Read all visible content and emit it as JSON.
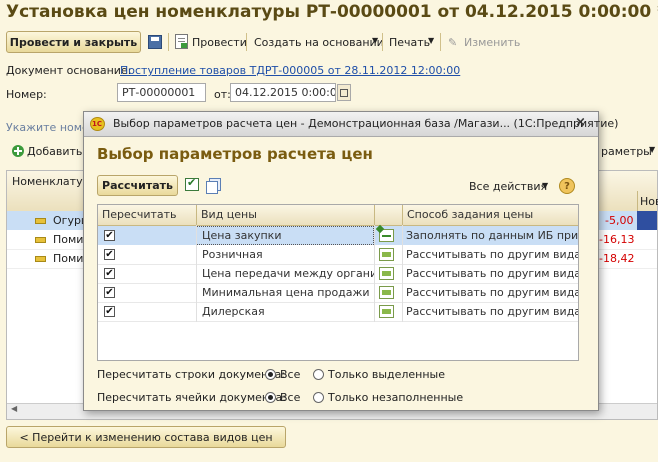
{
  "document": {
    "title": "Установка цен номенклатуры РТ-00000001 от 04.12.2015 0:00:00 *",
    "toolbar": {
      "post_close": "Провести и закрыть",
      "post": "Провести",
      "create_based": "Создать на основании",
      "print": "Печать",
      "edit": "Изменить"
    },
    "basis_label": "Документ основание:",
    "basis_link": "Поступление товаров ТДРТ-000005 от 28.11.2012 12:00:00",
    "number_label": "Номер:",
    "number_value": "РТ-00000001",
    "date_label": "от:",
    "date_value": "04.12.2015  0:00:00",
    "hint_fragment": "Укажите номе",
    "add_fragment": "Добавить",
    "params_fragment": "раметры",
    "table": {
      "col_nom": "Номенклатур",
      "col_new": "Нов",
      "rows": [
        {
          "name": "Огурц",
          "value": "-5,00"
        },
        {
          "name": "Поми",
          "value": "-16,13"
        },
        {
          "name": "Поми",
          "value": "-18,42"
        }
      ]
    },
    "back_button": "< Перейти к изменению состава видов цен"
  },
  "dialog": {
    "window_title": "Выбор параметров расчета цен - Демонстрационная база /Магази...  (1С:Предприятие)",
    "heading": "Выбор параметров расчета цен",
    "calc_button": "Рассчитать",
    "all_actions": "Все действия",
    "help": "?",
    "columns": {
      "recalc": "Пересчитать",
      "price_type": "Вид цены",
      "method": "Способ задания цены"
    },
    "rows": [
      {
        "checked": true,
        "price_type": "Цена закупки",
        "method": "Заполнять по данным ИБ при ...",
        "selected": true
      },
      {
        "checked": true,
        "price_type": "Розничная",
        "method": "Рассчитывать по другим вида...",
        "selected": false
      },
      {
        "checked": true,
        "price_type": "Цена передачи между организ...",
        "method": "Рассчитывать по другим вида...",
        "selected": false
      },
      {
        "checked": true,
        "price_type": "Минимальная цена продажи в ...",
        "method": "Рассчитывать по другим вида...",
        "selected": false
      },
      {
        "checked": true,
        "price_type": "Дилерская",
        "method": "Рассчитывать по другим вида...",
        "selected": false
      }
    ],
    "recalc_rows_label": "Пересчитать строки документа:",
    "recalc_rows_all": "Все",
    "recalc_rows_selected": "Только выделенные",
    "recalc_cells_label": "Пересчитать ячейки документа:",
    "recalc_cells_all": "Все",
    "recalc_cells_empty": "Только незаполненные",
    "chk_mark": "✔"
  },
  "colors": {
    "title": "#5a4a14",
    "dialog_heading": "#7a5c10",
    "link": "#1f4fa8",
    "negative": "#d40000",
    "selection": "#c9def5"
  }
}
